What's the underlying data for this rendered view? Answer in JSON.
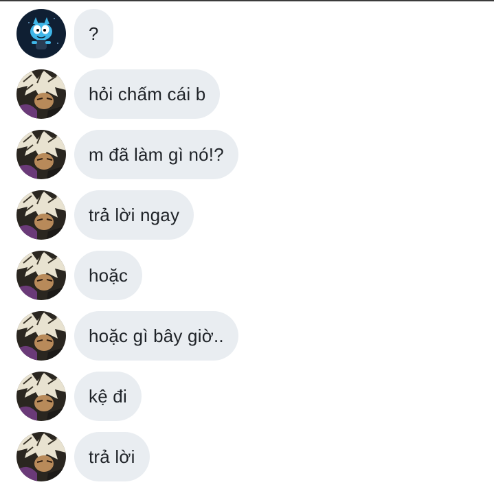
{
  "messages": [
    {
      "avatar": "gumball-avatar-icon",
      "text": "?"
    },
    {
      "avatar": "anime-character-avatar-icon",
      "text": "hỏi chấm cái b"
    },
    {
      "avatar": "anime-character-avatar-icon",
      "text": "m đã làm gì nó!?"
    },
    {
      "avatar": "anime-character-avatar-icon",
      "text": "trả lời ngay"
    },
    {
      "avatar": "anime-character-avatar-icon",
      "text": "hoặc"
    },
    {
      "avatar": "anime-character-avatar-icon",
      "text": "hoặc gì bây giờ.."
    },
    {
      "avatar": "anime-character-avatar-icon",
      "text": "kệ đi"
    },
    {
      "avatar": "anime-character-avatar-icon",
      "text": "trả lời"
    }
  ],
  "colors": {
    "bubble": "#e9edf1",
    "text": "#1f2328",
    "gumball_bg": "#0f1f33",
    "gumball_blue": "#3fb6e8"
  }
}
